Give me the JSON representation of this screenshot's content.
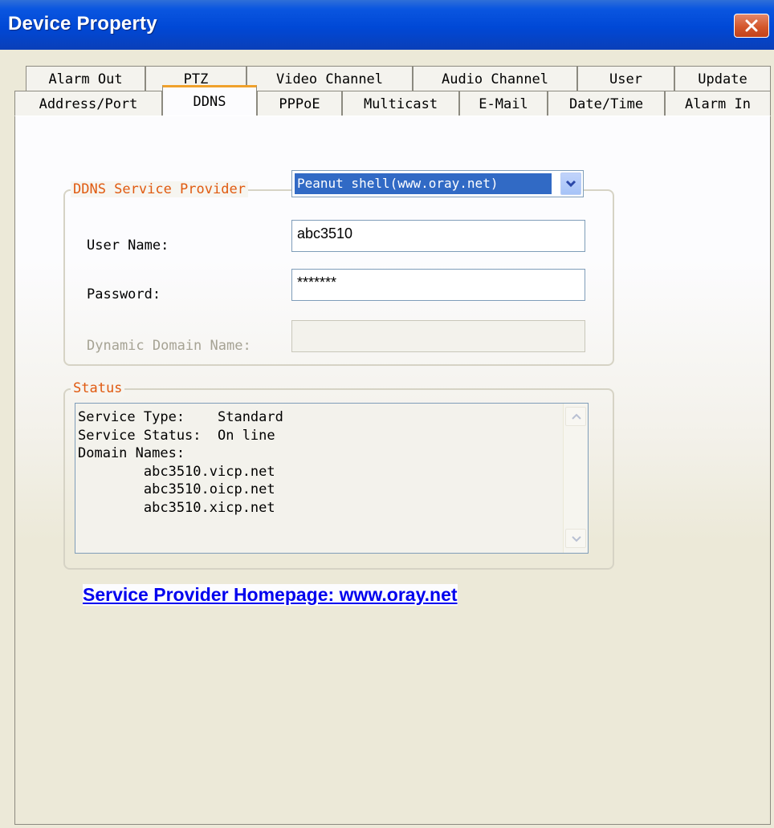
{
  "window": {
    "title": "Device Property"
  },
  "tabs": {
    "row1": [
      "Alarm Out",
      "PTZ",
      "Video Channel",
      "Audio Channel",
      "User",
      "Update"
    ],
    "row2": [
      "Address/Port",
      "DDNS",
      "PPPoE",
      "Multicast",
      "E-Mail",
      "Date/Time",
      "Alarm In"
    ],
    "active": "DDNS"
  },
  "ddns": {
    "group_label": "DDNS Service Provider",
    "provider_selected": "Peanut shell(www.oray.net)",
    "user_name_label": "User Name:",
    "user_name_value": "abc3510",
    "password_label": "Password:",
    "password_value": "*******",
    "domain_label": "Dynamic Domain Name:",
    "domain_value": ""
  },
  "status": {
    "group_label": "Status",
    "lines": [
      "Service Type:    Standard",
      "Service Status:  On line",
      "Domain Names:",
      "        abc3510.vicp.net",
      "        abc3510.oicp.net",
      "        abc3510.xicp.net"
    ]
  },
  "homepage_link": "Service Provider Homepage: www.oray.net",
  "colors": {
    "title_bar": "#0048d6",
    "group_label": "#e05a10",
    "tab_accent": "#f0a12b",
    "selection": "#316ac5",
    "link": "#0000ee"
  }
}
